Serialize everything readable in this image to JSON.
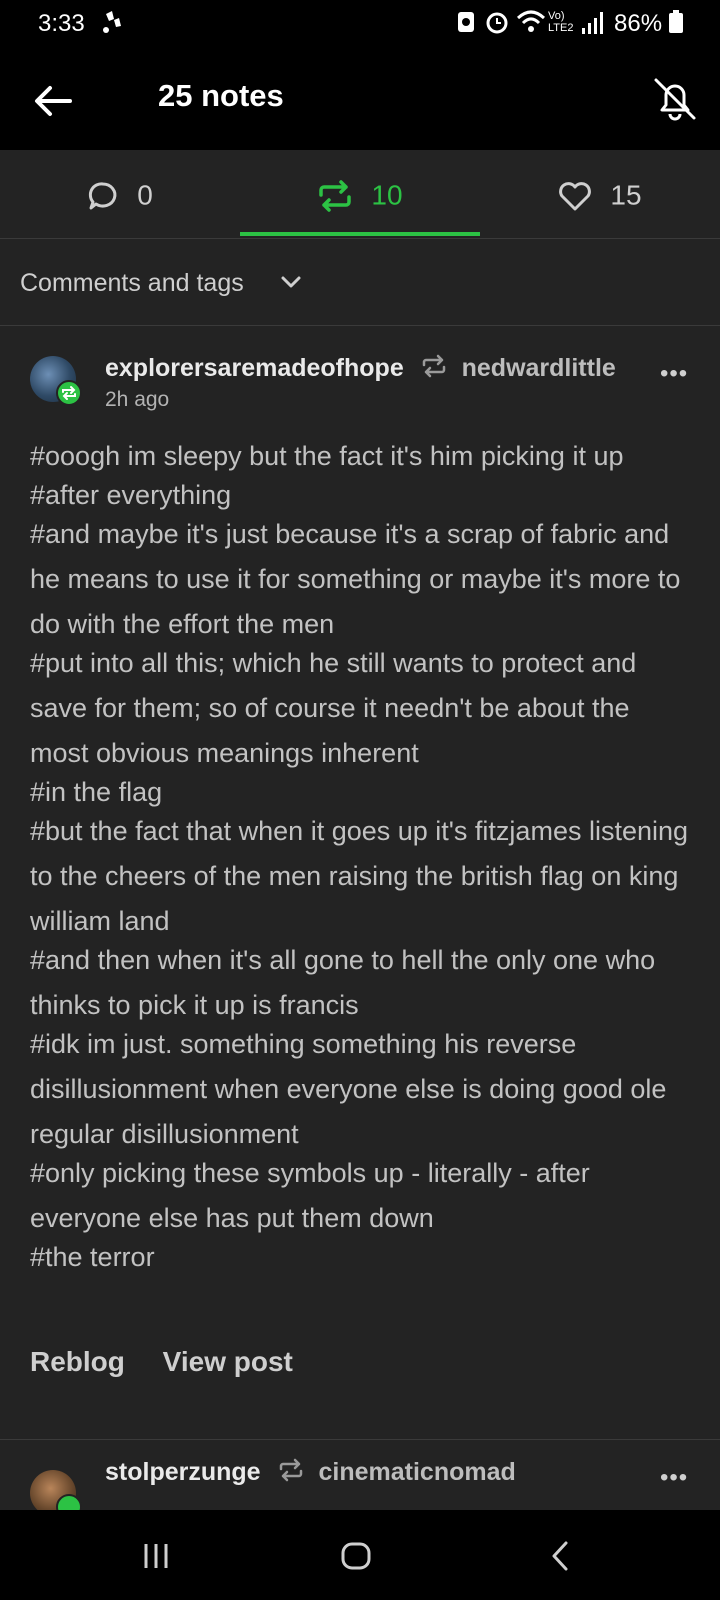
{
  "status_bar": {
    "time": "3:33",
    "battery": "86%",
    "icons": [
      "notification-icon",
      "recycle-icon",
      "alarm-icon",
      "wifi-icon",
      "volte-icon",
      "signal-icon",
      "battery-icon"
    ]
  },
  "header": {
    "title": "25 notes",
    "back_icon": "back-arrow-icon",
    "bell_icon": "bell-off-icon"
  },
  "tabs": [
    {
      "icon": "comment-icon",
      "count": "0",
      "active": false
    },
    {
      "icon": "reblog-icon",
      "count": "10",
      "active": true
    },
    {
      "icon": "heart-icon",
      "count": "15",
      "active": false
    }
  ],
  "filter": {
    "label": "Comments and tags",
    "icon": "chevron-down-icon"
  },
  "notes": [
    {
      "username": "explorersaremadeofhope",
      "reblogged_from": "nedwardlittle",
      "time": "2h ago",
      "tags": [
        "#ooogh im sleepy but the fact it's him picking it up",
        "#after everything",
        "#and maybe it's just because it's a scrap of fabric and he means to use it for something or maybe it's more to do with the effort the men",
        "#put into all this; which he still wants to protect and save for them; so of course it needn't be about the most obvious meanings inherent",
        "#in the flag",
        "#but the fact that when it goes up it's fitzjames listening to the cheers of the men raising the british flag on king william land",
        "#and then when it's all gone to hell the only one who thinks to pick it up is francis",
        "#idk im just. something something his reverse disillusionment when everyone else is doing good ole regular disillusionment",
        "#only picking these symbols up - literally - after everyone else has put them down",
        "#the terror"
      ],
      "actions": {
        "reblog": "Reblog",
        "view": "View post"
      },
      "more": "•••"
    },
    {
      "username": "stolperzunge",
      "reblogged_from": "cinematicnomad",
      "more": "•••"
    }
  ],
  "colors": {
    "accent": "#2cc244",
    "background": "#232323",
    "bar": "#000000"
  }
}
